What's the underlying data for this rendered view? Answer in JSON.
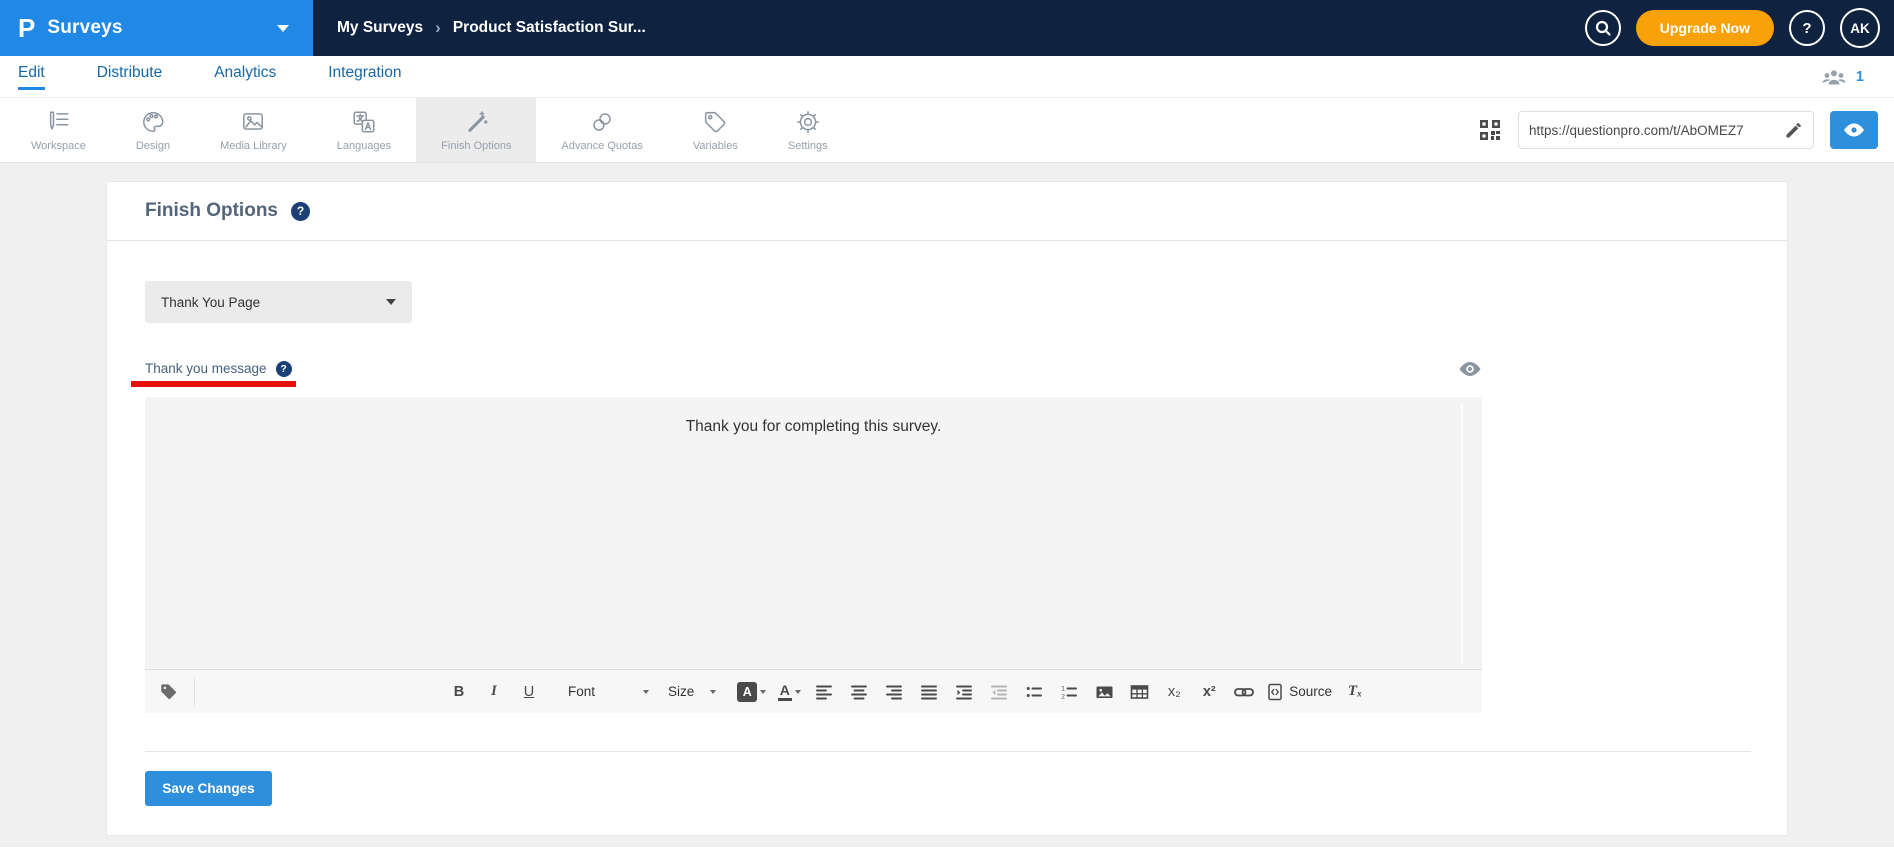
{
  "ui": {
    "help_glyph": "?",
    "breadcrumb_separator": "›"
  },
  "topbar": {
    "logo_letter": "P",
    "product_name": "Surveys",
    "breadcrumb_parent": "My Surveys",
    "breadcrumb_current": "Product Satisfaction Sur...",
    "upgrade_label": "Upgrade Now",
    "avatar_initials": "AK"
  },
  "tabs": {
    "items": [
      {
        "label": "Edit",
        "active": true
      },
      {
        "label": "Distribute",
        "active": false
      },
      {
        "label": "Analytics",
        "active": false
      },
      {
        "label": "Integration",
        "active": false
      }
    ],
    "collaborator_count": "1"
  },
  "ribbon": {
    "items": [
      {
        "label": "Workspace"
      },
      {
        "label": "Design"
      },
      {
        "label": "Media Library"
      },
      {
        "label": "Languages"
      },
      {
        "label": "Finish Options",
        "active": true
      },
      {
        "label": "Advance Quotas"
      },
      {
        "label": "Variables"
      },
      {
        "label": "Settings"
      }
    ],
    "survey_url": "https://questionpro.com/t/AbOMEZ7"
  },
  "content": {
    "page_title": "Finish Options",
    "finish_type_selected": "Thank You Page",
    "message_label": "Thank you message",
    "save_button_label": "Save Changes"
  },
  "editor": {
    "text": "Thank you for completing this survey.",
    "toolbar": {
      "bold": "B",
      "italic": "I",
      "underline": "U",
      "font_label": "Font",
      "size_label": "Size",
      "bgcolor_letter": "A",
      "textcolor_letter": "A",
      "subscript": "x₂",
      "superscript": "x²",
      "source_label": "Source",
      "remove_format": "Tₓ"
    }
  },
  "colors": {
    "brand_blue": "#2089e5",
    "navy": "#0f2240",
    "orange": "#f9a109",
    "accent_blue": "#2e8fdd",
    "annotation_red": "#e8100c"
  }
}
